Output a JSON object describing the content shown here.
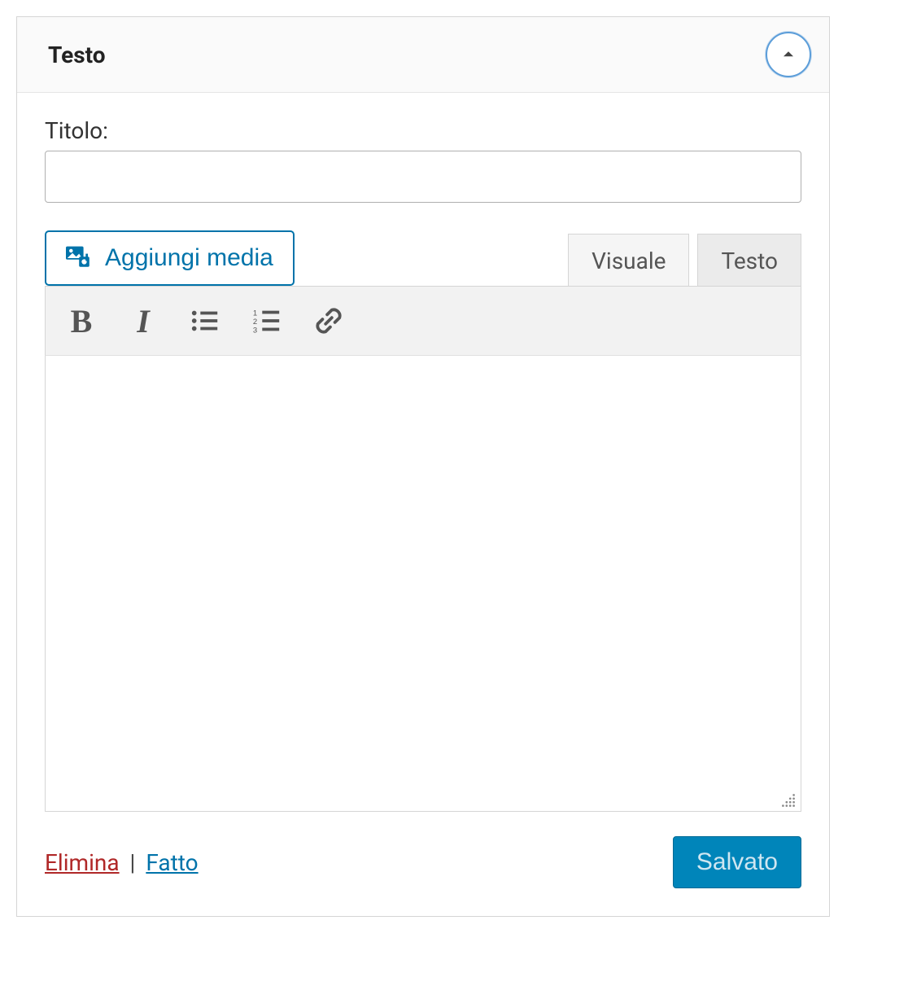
{
  "widget": {
    "title": "Testo"
  },
  "form": {
    "title_label": "Titolo:",
    "title_value": ""
  },
  "editor": {
    "add_media_label": "Aggiungi media",
    "tabs": {
      "visual": "Visuale",
      "text": "Testo"
    }
  },
  "footer": {
    "delete_label": "Elimina",
    "separator": " | ",
    "done_label": "Fatto",
    "saved_label": "Salvato"
  }
}
